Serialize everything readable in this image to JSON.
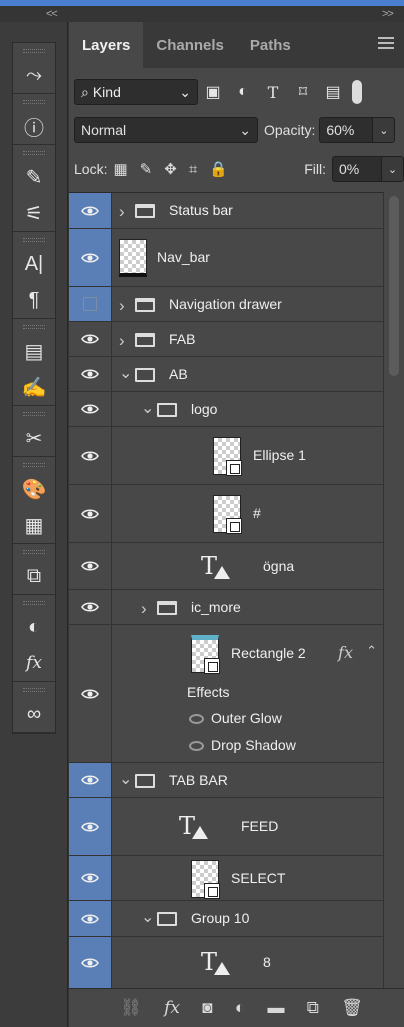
{
  "window": {
    "collapse_left": "<<",
    "collapse_right": ">>"
  },
  "tools": [
    {
      "icon": "history-icon",
      "glyph": "⤳"
    },
    {
      "icon": "info-icon",
      "glyph": "ⓘ"
    },
    {
      "icon": "brush-settings-icon",
      "glyph": "✎"
    },
    {
      "icon": "adjustments-icon",
      "glyph": "⚟"
    },
    {
      "icon": "character-icon",
      "glyph": "A|"
    },
    {
      "icon": "paragraph-icon",
      "glyph": "¶"
    },
    {
      "icon": "glyph-panel-icon",
      "glyph": "▤"
    },
    {
      "icon": "notes-icon",
      "glyph": "✍"
    },
    {
      "icon": "tool-presets-icon",
      "glyph": "✂"
    },
    {
      "icon": "swatches-icon",
      "glyph": "🎨"
    },
    {
      "icon": "grid-icon",
      "glyph": "▦"
    },
    {
      "icon": "3d-icon",
      "glyph": "⧉"
    },
    {
      "icon": "mask-icon",
      "glyph": "◐"
    },
    {
      "icon": "styles-icon",
      "glyph": "fx"
    },
    {
      "icon": "creative-cloud-icon",
      "glyph": "∞"
    }
  ],
  "tabs": [
    "Layers",
    "Channels",
    "Paths"
  ],
  "filter": {
    "kind_label": "Kind"
  },
  "blend": {
    "mode": "Normal",
    "opacity_label": "Opacity:",
    "opacity": "60%",
    "fill_label": "Fill:",
    "fill": "0%",
    "lock_label": "Lock:"
  },
  "layers": [
    {
      "name": "Status bar",
      "type": "group",
      "selected": true,
      "visible": true
    },
    {
      "name": "Nav_bar",
      "type": "layer",
      "selected": true,
      "visible": true
    },
    {
      "name": "Navigation drawer",
      "type": "group",
      "selected": true,
      "visible": false
    },
    {
      "name": "FAB",
      "type": "group",
      "selected": false,
      "visible": true
    },
    {
      "name": "AB",
      "type": "group-open",
      "selected": false,
      "visible": true
    },
    {
      "name": "logo",
      "type": "group-open",
      "selected": false,
      "visible": true
    },
    {
      "name": "Ellipse 1",
      "type": "shape",
      "selected": false,
      "visible": true
    },
    {
      "name": "#",
      "type": "shape",
      "selected": false,
      "visible": true
    },
    {
      "name": "ögna",
      "type": "text",
      "selected": false,
      "visible": true
    },
    {
      "name": "ic_more",
      "type": "group",
      "selected": false,
      "visible": true
    },
    {
      "name": "Rectangle 2",
      "type": "shape-fx",
      "selected": false,
      "visible": true,
      "fx": "fx"
    },
    {
      "name": "TAB BAR",
      "type": "group-open",
      "selected": true,
      "visible": true
    },
    {
      "name": "FEED",
      "type": "text",
      "selected": true,
      "visible": true
    },
    {
      "name": "SELECT",
      "type": "shape",
      "selected": true,
      "visible": true
    },
    {
      "name": "Group 10",
      "type": "group-open",
      "selected": true,
      "visible": true
    },
    {
      "name": "8",
      "type": "text",
      "selected": true,
      "visible": true
    }
  ],
  "effects": {
    "title": "Effects",
    "items": [
      "Outer Glow",
      "Drop Shadow"
    ]
  },
  "bottom_icons": [
    "link-icon",
    "fx-icon",
    "add-mask-icon",
    "adjustment-layer-icon",
    "new-group-icon",
    "new-layer-icon",
    "delete-icon"
  ]
}
